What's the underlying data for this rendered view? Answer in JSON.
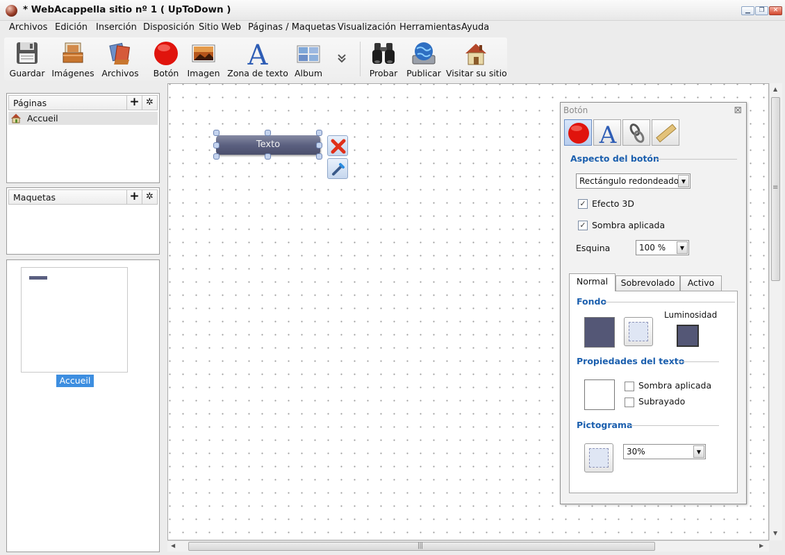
{
  "window": {
    "title": "* WebAcappella sitio nº 1 ( UpToDown )"
  },
  "menu": [
    "Archivos",
    "Edición",
    "Inserción",
    "Disposición",
    "Sitio Web",
    "Páginas / Maquetas",
    "Visualización",
    "Herramientas",
    "Ayuda"
  ],
  "toolbar": {
    "guardar": "Guardar",
    "imagenes": "Imágenes",
    "archivos": "Archivos",
    "boton": "Botón",
    "imagen": "Imagen",
    "zona_texto": "Zona de texto",
    "album": "Album",
    "probar": "Probar",
    "publicar": "Publicar",
    "visitar": "Visitar su sitio"
  },
  "pages_panel": {
    "title": "Páginas",
    "items": [
      "Accueil"
    ]
  },
  "layouts_panel": {
    "title": "Maquetas"
  },
  "preview_panel": {
    "label": "Accueil"
  },
  "canvas": {
    "button_text": "Texto"
  },
  "properties": {
    "title": "Botón",
    "aspect_section": "Aspecto del botón",
    "shape_value": "Rectángulo redondeado",
    "effect_3d": {
      "label": "Efecto 3D",
      "checked": true
    },
    "shadow": {
      "label": "Sombra aplicada",
      "checked": true
    },
    "corner_label": "Esquina",
    "corner_value": "100 %",
    "tabs": [
      "Normal",
      "Sobrevolado",
      "Activo"
    ],
    "background_section": "Fondo",
    "luminosity_label": "Luminosidad",
    "text_section": "Propiedades del texto",
    "text_shadow": {
      "label": "Sombra aplicada",
      "checked": false
    },
    "underline": {
      "label": "Subrayado",
      "checked": false
    },
    "pictogram_section": "Pictograma",
    "pictogram_value": "30%",
    "colors": {
      "background": "#545776",
      "luminosity": "#545776",
      "text": "#ffffff"
    }
  },
  "icons": [
    "floppy-disk-icon",
    "images-tray-icon",
    "files-icon",
    "red-button-icon",
    "picture-icon",
    "text-a-icon",
    "album-icon",
    "more-chevron-icon",
    "binoculars-icon",
    "globe-monitor-icon",
    "house-icon"
  ]
}
